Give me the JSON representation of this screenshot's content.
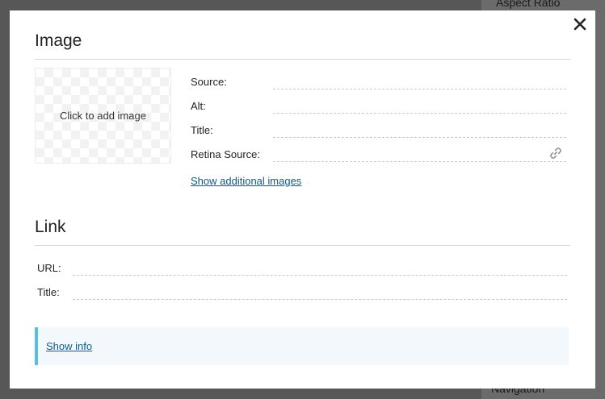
{
  "background": {
    "top_text": "Aspect Ratio",
    "bottom_text": "Navigation"
  },
  "image_section": {
    "title": "Image",
    "dropzone_label": "Click to add image",
    "fields": {
      "source_label": "Source:",
      "source_value": "",
      "alt_label": "Alt:",
      "alt_value": "",
      "title_label": "Title:",
      "title_value": "",
      "retina_label": "Retina Source:",
      "retina_value": ""
    },
    "additional_link": "Show additional images"
  },
  "link_section": {
    "title": "Link",
    "fields": {
      "url_label": "URL:",
      "url_value": "",
      "title_label": "Title:",
      "title_value": ""
    }
  },
  "info": {
    "link": "Show info",
    "accent_color": "#5bbde6"
  },
  "icons": {
    "close": "close-icon",
    "link": "link-icon"
  }
}
